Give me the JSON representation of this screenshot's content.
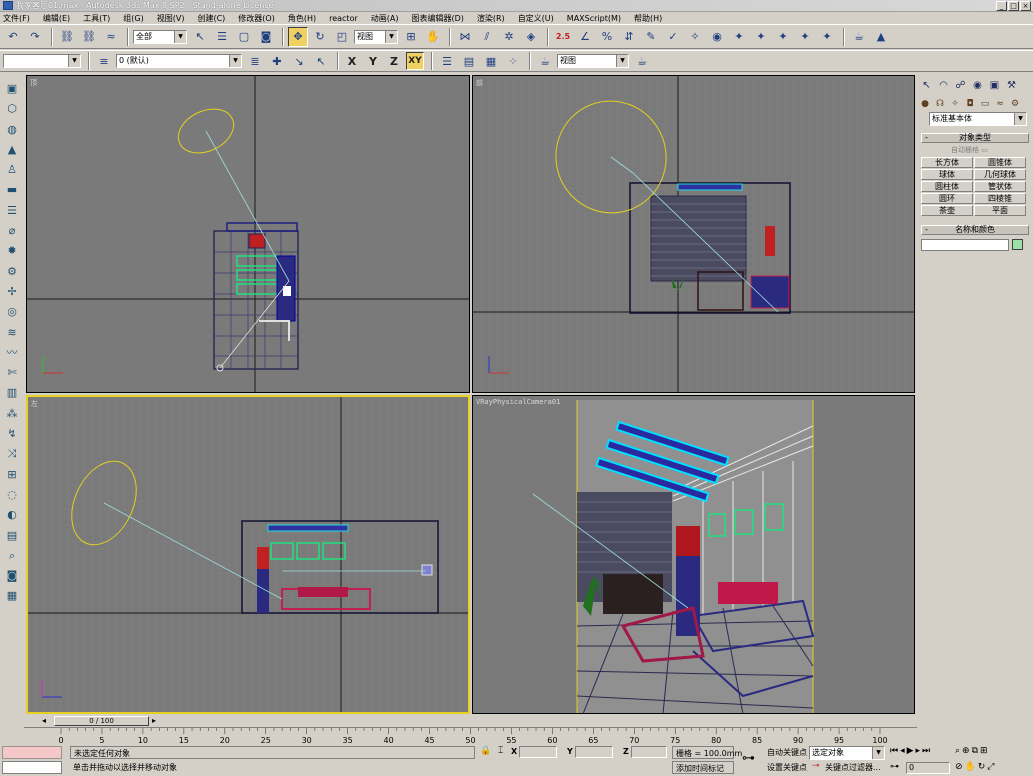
{
  "title": "我家客厅01.max - Autodesk 3ds Max 8 SP2 - Stand-alone License",
  "menu": [
    "文件(F)",
    "编辑(E)",
    "工具(T)",
    "组(G)",
    "视图(V)",
    "创建(C)",
    "修改器(O)",
    "角色(H)",
    "reactor",
    "动画(A)",
    "图表编辑器(D)",
    "渲染(R)",
    "自定义(U)",
    "MAXScript(M)",
    "帮助(H)"
  ],
  "toolbar1": {
    "selection_filter": "全部",
    "ref_coord": "视图",
    "snap_label": "2.5"
  },
  "toolbar2": {
    "layer_name": "0 (默认)",
    "axis_x": "X",
    "axis_y": "Y",
    "axis_z": "Z",
    "axis_xy": "XY",
    "render_view": "视图"
  },
  "viewports": {
    "top": {
      "label": "顶"
    },
    "front": {
      "label": "前"
    },
    "left": {
      "label": "左"
    },
    "camera": {
      "label": "VRayPhysicalCamera01"
    }
  },
  "command_panel": {
    "category": "标准基本体",
    "rollout_object_type": "对象类型",
    "auto_grid": "自动栅格",
    "objects": [
      "长方体",
      "圆锥体",
      "球体",
      "几何球体",
      "圆柱体",
      "管状体",
      "圆环",
      "四棱锥",
      "茶壶",
      "平面"
    ],
    "rollout_name_color": "名称和颜色",
    "color_swatch": "#9ce0a8"
  },
  "timeline": {
    "slider": "0 / 100",
    "ticks": [
      "0",
      "5",
      "10",
      "15",
      "20",
      "25",
      "30",
      "35",
      "40",
      "45",
      "50",
      "55",
      "60",
      "65",
      "70",
      "75",
      "80",
      "85",
      "90",
      "95",
      "100"
    ]
  },
  "status": {
    "selection": "未选定任何对象",
    "prompt": "单击并拖动以选择并移动对象",
    "x_label": "X",
    "y_label": "Y",
    "z_label": "Z",
    "grid": "栅格 = 100.0mm",
    "add_time_tag": "添加时间标记",
    "auto_key": "自动关键点",
    "set_key": "设置关键点",
    "selected_object": "选定对象",
    "key_filters": "关键点过滤器...",
    "frame": "0"
  }
}
